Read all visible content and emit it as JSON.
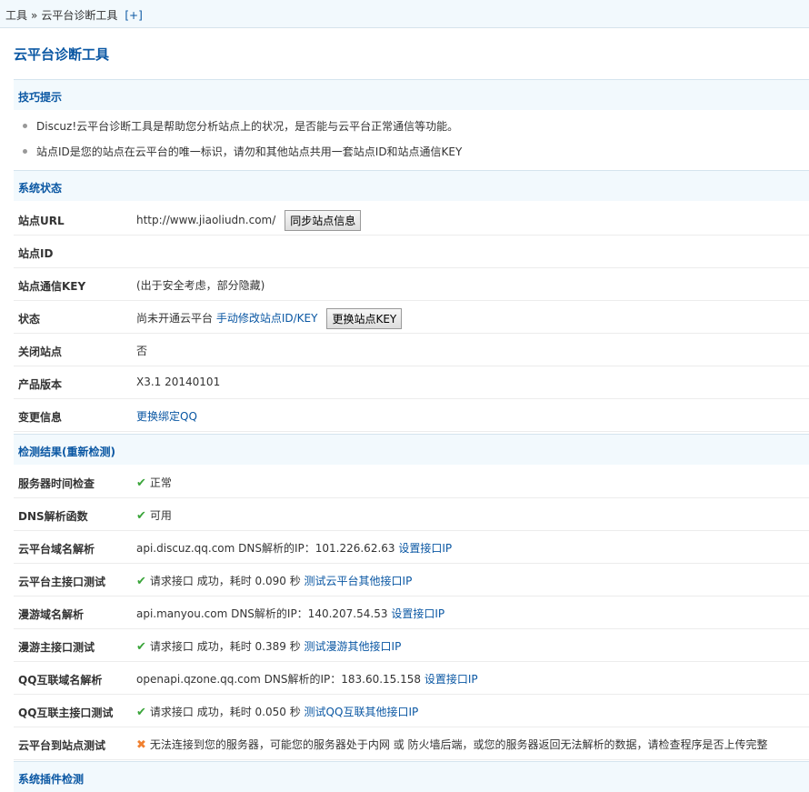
{
  "breadcrumb": {
    "tools": "工具",
    "separator": "»",
    "current": "云平台诊断工具",
    "expand": "[+]"
  },
  "page_title": "云平台诊断工具",
  "tips": {
    "header": "技巧提示",
    "items": [
      "Discuz!云平台诊断工具是帮助您分析站点上的状况，是否能与云平台正常通信等功能。",
      "站点ID是您的站点在云平台的唯一标识，请勿和其他站点共用一套站点ID和站点通信KEY"
    ]
  },
  "system_status": {
    "header": "系统状态",
    "site_url": {
      "label": "站点URL",
      "value": "http://www.jiaoliudn.com/",
      "button": "同步站点信息"
    },
    "site_id": {
      "label": "站点ID",
      "value": ""
    },
    "site_key": {
      "label": "站点通信KEY",
      "value": "(出于安全考虑，部分隐藏)"
    },
    "status": {
      "label": "状态",
      "value": "尚未开通云平台",
      "link": "手动修改站点ID/KEY",
      "button": "更换站点KEY"
    },
    "closed": {
      "label": "关闭站点",
      "value": "否"
    },
    "version": {
      "label": "产品版本",
      "value": "X3.1 20140101"
    },
    "change": {
      "label": "变更信息",
      "link": "更换绑定QQ"
    }
  },
  "check": {
    "header": "检测结果(重新检测)",
    "rows": [
      {
        "label": "服务器时间检查",
        "status": "ok",
        "text": "正常",
        "link": ""
      },
      {
        "label": "DNS解析函数",
        "status": "ok",
        "text": "可用",
        "link": ""
      },
      {
        "label": "云平台域名解析",
        "status": "none",
        "text": "api.discuz.qq.com DNS解析的IP：101.226.62.63",
        "link": "设置接口IP"
      },
      {
        "label": "云平台主接口测试",
        "status": "ok",
        "text": "请求接口 成功，耗时 0.090 秒",
        "link": "测试云平台其他接口IP"
      },
      {
        "label": "漫游域名解析",
        "status": "none",
        "text": "api.manyou.com DNS解析的IP：140.207.54.53",
        "link": "设置接口IP"
      },
      {
        "label": "漫游主接口测试",
        "status": "ok",
        "text": "请求接口 成功，耗时 0.389 秒",
        "link": "测试漫游其他接口IP"
      },
      {
        "label": "QQ互联域名解析",
        "status": "none",
        "text": "openapi.qzone.qq.com DNS解析的IP：183.60.15.158",
        "link": "设置接口IP"
      },
      {
        "label": "QQ互联主接口测试",
        "status": "ok",
        "text": "请求接口 成功，耗时 0.050 秒",
        "link": "测试QQ互联其他接口IP"
      },
      {
        "label": "云平台到站点测试",
        "status": "error",
        "text": "无法连接到您的服务器，可能您的服务器处于内网 或 防火墙后端，或您的服务器返回无法解析的数据，请检查程序是否上传完整",
        "link": ""
      }
    ]
  },
  "plugin_check": {
    "header": "系统插件检测"
  },
  "icons": {
    "ok": "check-icon",
    "error": "cross-icon"
  },
  "colors": {
    "ok": "#3aa53a",
    "error": "#f08030",
    "link": "#0a57a3",
    "section_bg": "#f2f9fd"
  }
}
